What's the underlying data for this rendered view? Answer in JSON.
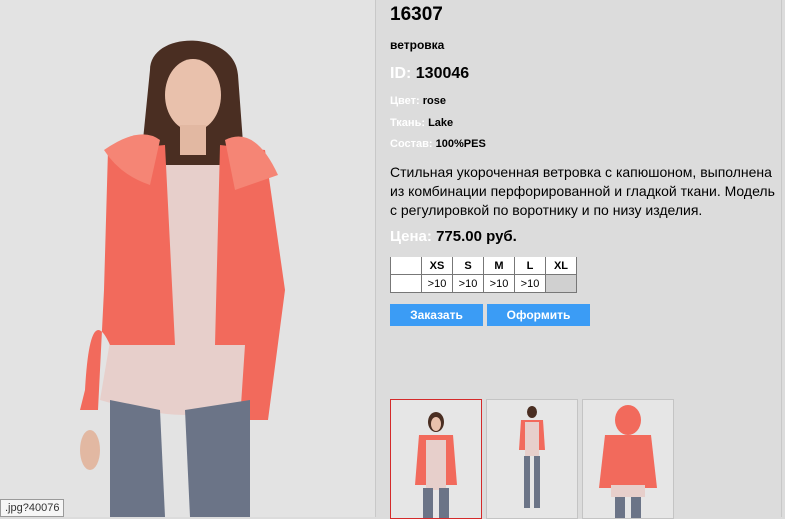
{
  "image_tooltip": ".jpg?40076",
  "product": {
    "code": "16307",
    "type": "ветровка",
    "id_label": "ID:",
    "id_value": "130046",
    "color_label": "Цвет:",
    "color_value": "rose",
    "fabric_label": "Ткань:",
    "fabric_value": "Lake",
    "composition_label": "Состав:",
    "composition_value": "100%PES",
    "description": "Стильная укороченная ветровка с капюшоном, выполнена из комбинации  перфорированной и гладкой  ткани. Модель с регулировкой по воротнику и по низу изделия.",
    "price_label": "Цена:",
    "price_value": "775.00 руб."
  },
  "sizes": {
    "headers": [
      "",
      "XS",
      "S",
      "M",
      "L",
      "XL"
    ],
    "stock": [
      "",
      ">10",
      ">10",
      ">10",
      ">10",
      ""
    ]
  },
  "buttons": {
    "order": "Заказать",
    "checkout": "Оформить"
  },
  "colors": {
    "accent_button": "#3b9cf5",
    "jacket": "#f26a5c",
    "active_thumb_border": "#d42a2a"
  }
}
